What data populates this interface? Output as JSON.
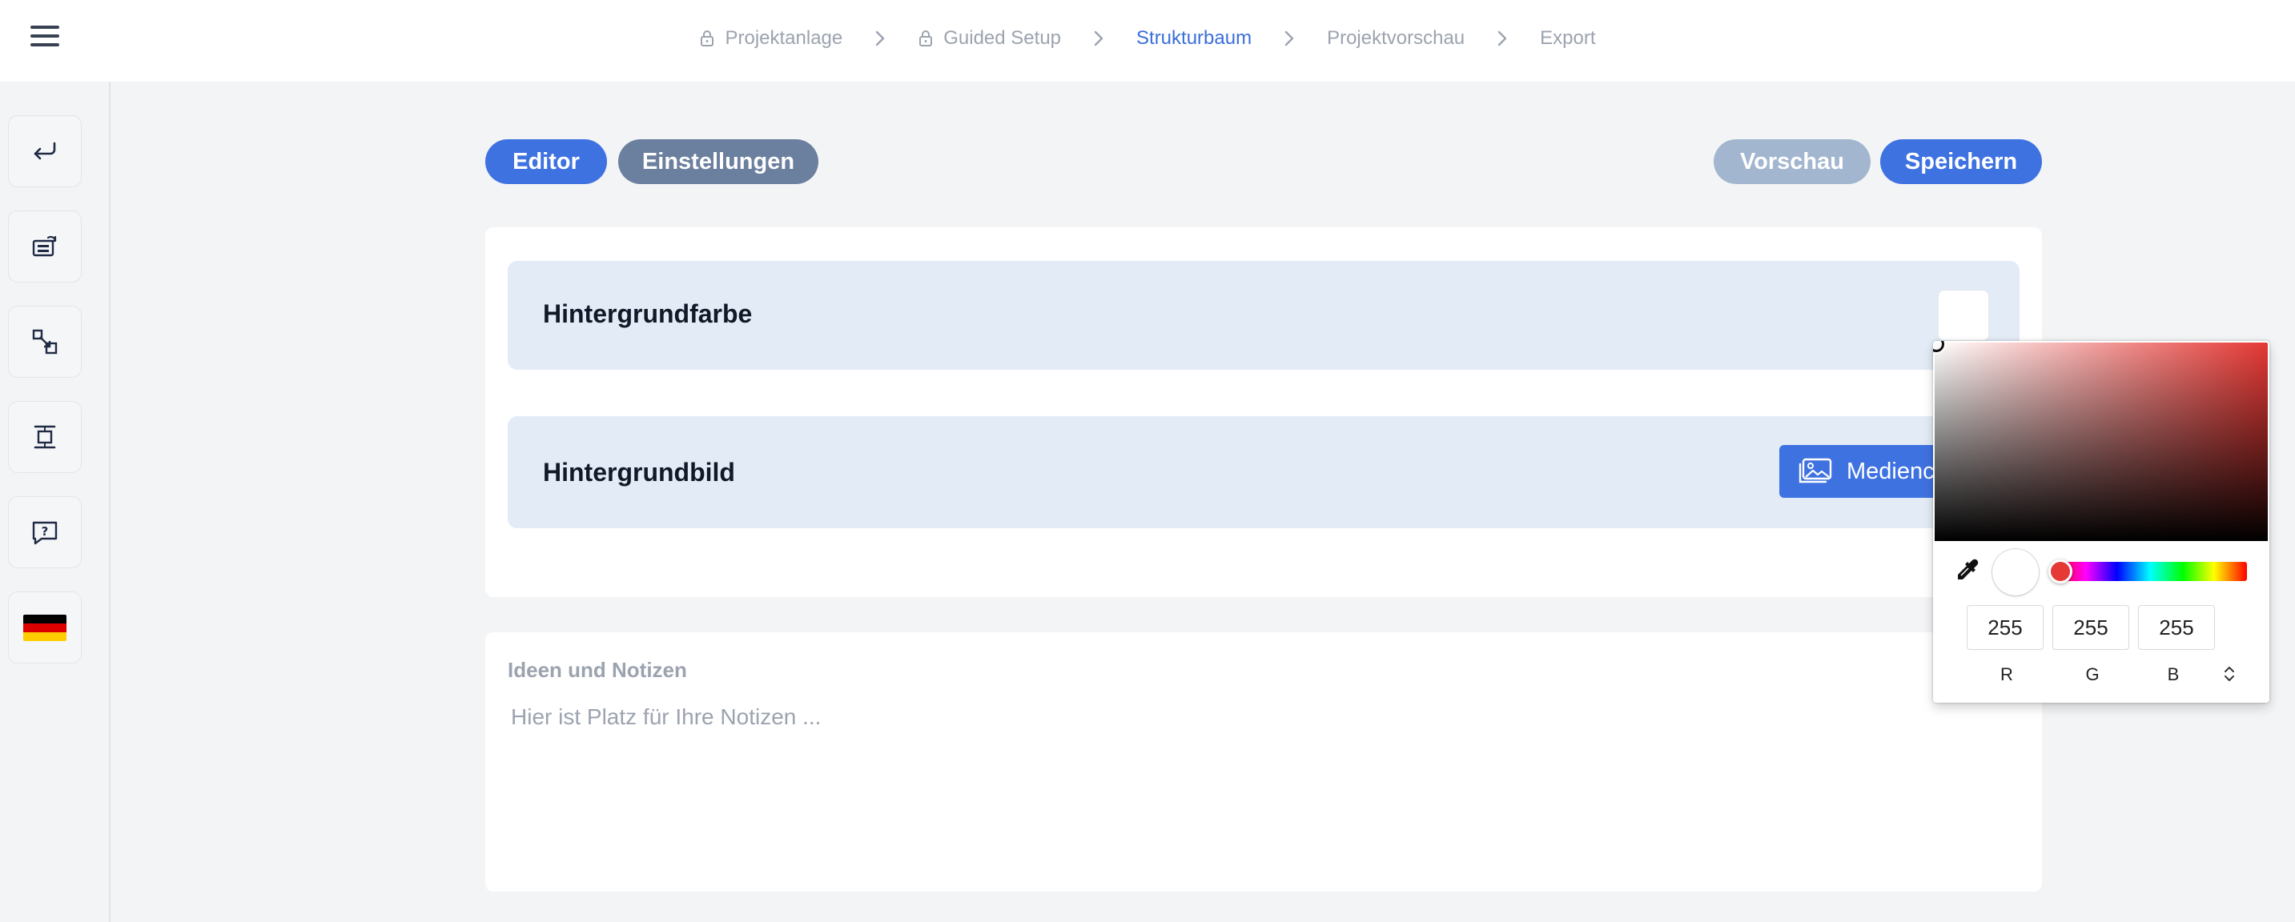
{
  "breadcrumb": {
    "steps": [
      {
        "label": "Projektanlage",
        "locked": true
      },
      {
        "label": "Guided Setup",
        "locked": true
      },
      {
        "label": "Strukturbaum",
        "active": true
      },
      {
        "label": "Projektvorschau"
      },
      {
        "label": "Export"
      }
    ]
  },
  "rail": {
    "icons": [
      "return-icon",
      "layout-edit-icon",
      "resize-icon",
      "spacing-icon",
      "help-icon",
      "german-flag-icon"
    ],
    "flag_colors": [
      "#000000",
      "#dd0000",
      "#ffce00"
    ]
  },
  "toolbar": {
    "editor_label": "Editor",
    "settings_label": "Einstellungen",
    "preview_label": "Vorschau",
    "save_label": "Speichern"
  },
  "settings": {
    "background_color_label": "Hintergrundfarbe",
    "background_image_label": "Hintergrundbild",
    "media_button_label": "Mediencenter"
  },
  "notes": {
    "title": "Ideen und Notizen",
    "placeholder": "Hier ist Platz für Ihre Notizen ..."
  },
  "color_picker": {
    "hue_color": "#e53935",
    "selected_color": "#ffffff",
    "r": "255",
    "g": "255",
    "b": "255",
    "r_label": "R",
    "g_label": "G",
    "b_label": "B"
  },
  "colors": {
    "primary": "#3f72e1",
    "secondary": "#6b7f9e",
    "disabled": "#a3b6d0",
    "active_step": "#3b6fd9"
  }
}
